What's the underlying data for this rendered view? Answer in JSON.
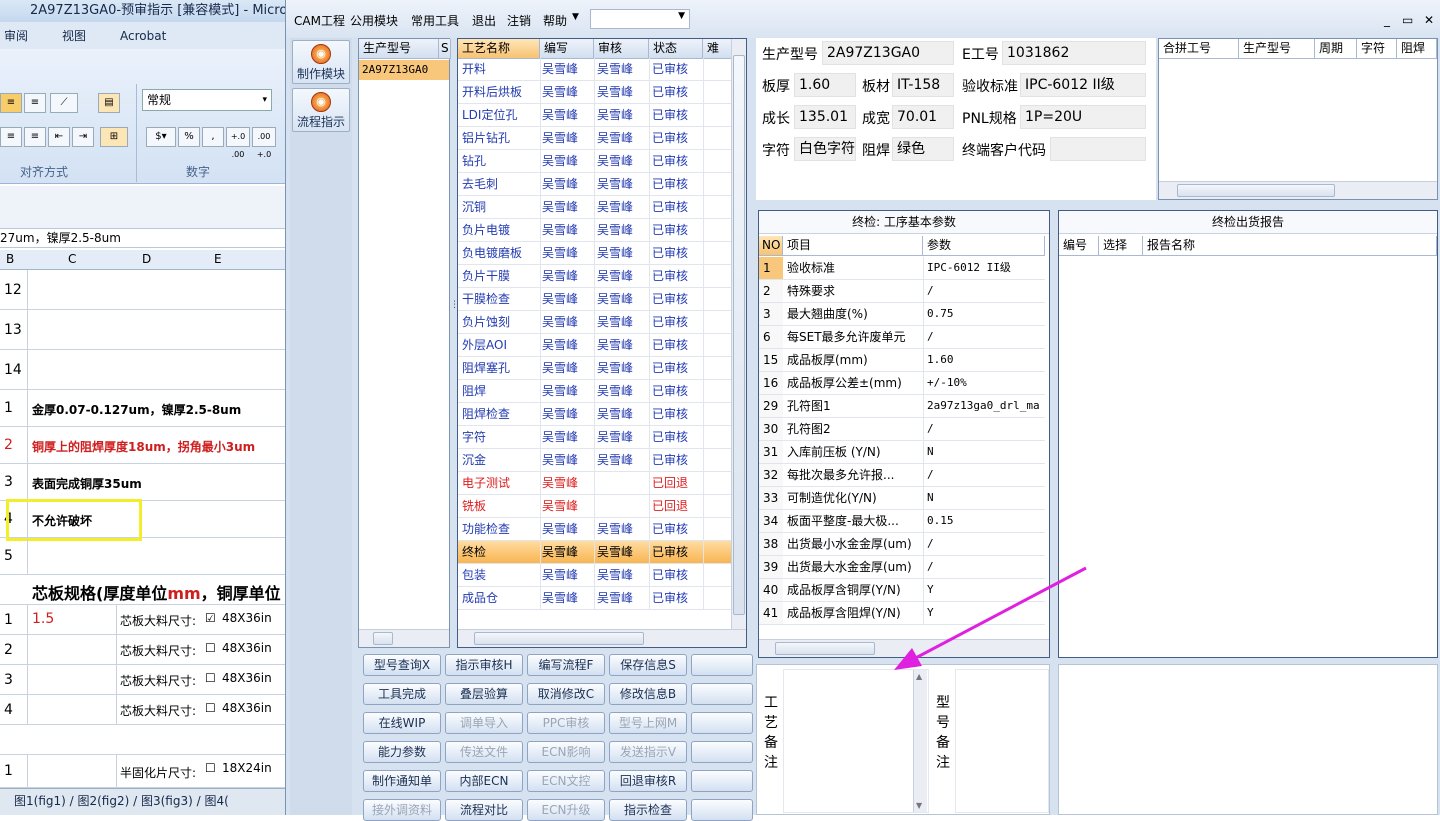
{
  "excel": {
    "title": "2A97Z13GA0-预审指示 [兼容模式] - Microso",
    "tabs": [
      "审阅",
      "视图",
      "Acrobat"
    ],
    "style_value": "常规",
    "groups": [
      "对齐方式",
      "数字"
    ],
    "number_buttons": [
      "%",
      ",",
      "+.0 .00",
      ".00 +.0"
    ],
    "formula": "27um，镍厚2.5-8um",
    "columns": [
      "B",
      "C",
      "D",
      "E"
    ],
    "rows": [
      {
        "n": "12",
        "text": ""
      },
      {
        "n": "13",
        "text": ""
      },
      {
        "n": "14",
        "text": ""
      },
      {
        "n": "1",
        "text": "金厚0.07-0.127um，镍厚2.5-8um"
      },
      {
        "n": "2",
        "text": "铜厚上的阻焊厚度18um，拐角最小3um"
      },
      {
        "n": "3",
        "text": "表面完成铜厚35um"
      },
      {
        "n": "4",
        "text": "不允许破坏"
      },
      {
        "n": "5",
        "text": ""
      }
    ],
    "core_title_a": "芯板规格(厚度单位",
    "core_title_mm": "mm",
    "core_title_b": "，铜厚单位",
    "core_rows": [
      {
        "n": "1",
        "val": "1.5",
        "label": "芯板大料尺寸:",
        "size": "48X36in",
        "checked": true
      },
      {
        "n": "2",
        "val": "",
        "label": "芯板大料尺寸:",
        "size": "48X36in",
        "checked": false
      },
      {
        "n": "3",
        "val": "",
        "label": "芯板大料尺寸:",
        "size": "48X36in",
        "checked": false
      },
      {
        "n": "4",
        "val": "",
        "label": "芯板大料尺寸:",
        "size": "48X36in",
        "checked": false
      }
    ],
    "semi_row": {
      "n": "1",
      "label": "半固化片尺寸:",
      "size": "18X24in"
    },
    "sheets": "图1(fig1) / 图2(fig2) / 图3(fig3) / 图4("
  },
  "menu": [
    "CAM工程",
    "公用模块",
    "常用工具",
    "退出",
    "注销",
    "帮助"
  ],
  "left_buttons": [
    "制作模块",
    "流程指示"
  ],
  "model_list": {
    "headers": [
      "生产型号",
      "S"
    ],
    "items": [
      "2A97Z13GA0"
    ]
  },
  "process": {
    "headers": [
      "工艺名称",
      "编写",
      "审核",
      "状态",
      "难"
    ],
    "rows": [
      {
        "name": "开料",
        "writer": "吴雪峰",
        "reviewer": "吴雪峰",
        "status": "已审核"
      },
      {
        "name": "开料后烘板",
        "writer": "吴雪峰",
        "reviewer": "吴雪峰",
        "status": "已审核"
      },
      {
        "name": "LDI定位孔",
        "writer": "吴雪峰",
        "reviewer": "吴雪峰",
        "status": "已审核"
      },
      {
        "name": "铝片钻孔",
        "writer": "吴雪峰",
        "reviewer": "吴雪峰",
        "status": "已审核"
      },
      {
        "name": "钻孔",
        "writer": "吴雪峰",
        "reviewer": "吴雪峰",
        "status": "已审核"
      },
      {
        "name": "去毛刺",
        "writer": "吴雪峰",
        "reviewer": "吴雪峰",
        "status": "已审核"
      },
      {
        "name": "沉铜",
        "writer": "吴雪峰",
        "reviewer": "吴雪峰",
        "status": "已审核"
      },
      {
        "name": "负片电镀",
        "writer": "吴雪峰",
        "reviewer": "吴雪峰",
        "status": "已审核"
      },
      {
        "name": "负电镀磨板",
        "writer": "吴雪峰",
        "reviewer": "吴雪峰",
        "status": "已审核"
      },
      {
        "name": "负片干膜",
        "writer": "吴雪峰",
        "reviewer": "吴雪峰",
        "status": "已审核"
      },
      {
        "name": "干膜检查",
        "writer": "吴雪峰",
        "reviewer": "吴雪峰",
        "status": "已审核"
      },
      {
        "name": "负片蚀刻",
        "writer": "吴雪峰",
        "reviewer": "吴雪峰",
        "status": "已审核"
      },
      {
        "name": "外层AOI",
        "writer": "吴雪峰",
        "reviewer": "吴雪峰",
        "status": "已审核"
      },
      {
        "name": "阻焊塞孔",
        "writer": "吴雪峰",
        "reviewer": "吴雪峰",
        "status": "已审核"
      },
      {
        "name": "阻焊",
        "writer": "吴雪峰",
        "reviewer": "吴雪峰",
        "status": "已审核"
      },
      {
        "name": "阻焊检查",
        "writer": "吴雪峰",
        "reviewer": "吴雪峰",
        "status": "已审核"
      },
      {
        "name": "字符",
        "writer": "吴雪峰",
        "reviewer": "吴雪峰",
        "status": "已审核"
      },
      {
        "name": "沉金",
        "writer": "吴雪峰",
        "reviewer": "吴雪峰",
        "status": "已审核"
      },
      {
        "name": "电子测试",
        "writer": "吴雪峰",
        "reviewer": "",
        "status": "已回退"
      },
      {
        "name": "铣板",
        "writer": "吴雪峰",
        "reviewer": "",
        "status": "已回退"
      },
      {
        "name": "功能检查",
        "writer": "吴雪峰",
        "reviewer": "吴雪峰",
        "status": "已审核"
      },
      {
        "name": "终检",
        "writer": "吴雪峰",
        "reviewer": "吴雪峰",
        "status": "已审核"
      },
      {
        "name": "包装",
        "writer": "吴雪峰",
        "reviewer": "吴雪峰",
        "status": "已审核"
      },
      {
        "name": "成品仓",
        "writer": "吴雪峰",
        "reviewer": "吴雪峰",
        "status": "已审核"
      }
    ]
  },
  "actions": [
    [
      "型号查询X",
      "指示审核H",
      "编写流程F",
      "保存信息S",
      ""
    ],
    [
      "工具完成",
      "叠层验算",
      "取消修改C",
      "修改信息B",
      ""
    ],
    [
      "在线WIP",
      "调单导入",
      "PPC审核",
      "型号上网M",
      ""
    ],
    [
      "能力参数",
      "传送文件",
      "ECN影响",
      "发送指示V",
      ""
    ],
    [
      "制作通知单",
      "内部ECN",
      "ECN文控",
      "回退审核R",
      ""
    ],
    [
      "接外调资料",
      "流程对比",
      "ECN升级",
      "指示检查",
      ""
    ]
  ],
  "disabled_actions": [
    "调单导入",
    "PPC审核",
    "型号上网M",
    "传送文件",
    "ECN影响",
    "发送指示V",
    "ECN文控",
    "ECN升级",
    "接外调资料"
  ],
  "info": {
    "model_label": "生产型号",
    "model": "2A97Z13GA0",
    "eno_label": "E工号",
    "eno": "1031862",
    "thickness_label": "板厚",
    "thickness": "1.60",
    "material_label": "板材",
    "material": "IT-158",
    "standard_label": "验收标准",
    "standard": "IPC-6012 II级",
    "length_label": "成长",
    "length": "135.01",
    "width_label": "成宽",
    "width": "70.01",
    "pnl_label": "PNL规格",
    "pnl": "1P=20U",
    "char_label": "字符",
    "char": "白色字符",
    "mask_label": "阻焊",
    "mask": "绿色",
    "customer_label": "终端客户代码",
    "customer": ""
  },
  "merge_headers": [
    "合拼工号",
    "生产型号",
    "周期",
    "字符",
    "阻焊"
  ],
  "params": {
    "title": "终检: 工序基本参数",
    "headers": [
      "NO",
      "项目",
      "参数"
    ],
    "rows": [
      {
        "no": "1",
        "item": "验收标准",
        "value": "IPC-6012 II级"
      },
      {
        "no": "2",
        "item": "特殊要求",
        "value": "/"
      },
      {
        "no": "3",
        "item": "最大翘曲度(%)",
        "value": "0.75"
      },
      {
        "no": "6",
        "item": "每SET最多允许废单元",
        "value": "/"
      },
      {
        "no": "15",
        "item": "成品板厚(mm)",
        "value": "1.60"
      },
      {
        "no": "16",
        "item": "成品板厚公差±(mm)",
        "value": "+/-10%"
      },
      {
        "no": "29",
        "item": "孔符图1",
        "value": "2a97z13ga0_drl_ma"
      },
      {
        "no": "30",
        "item": "孔符图2",
        "value": "/"
      },
      {
        "no": "31",
        "item": "入库前压板 (Y/N)",
        "value": "N"
      },
      {
        "no": "32",
        "item": "每批次最多允许报...",
        "value": "/"
      },
      {
        "no": "33",
        "item": "可制造优化(Y/N)",
        "value": "N"
      },
      {
        "no": "34",
        "item": "板面平整度-最大极...",
        "value": "0.15"
      },
      {
        "no": "38",
        "item": "出货最小水金金厚(um)",
        "value": "/"
      },
      {
        "no": "39",
        "item": "出货最大水金金厚(um)",
        "value": "/"
      },
      {
        "no": "40",
        "item": "成品板厚含铜厚(Y/N)",
        "value": "Y"
      },
      {
        "no": "41",
        "item": "成品板厚含阻焊(Y/N)",
        "value": "Y"
      }
    ]
  },
  "report": {
    "title": "终检出货报告",
    "headers": [
      "编号",
      "选择",
      "报告名称"
    ]
  },
  "remarks": {
    "process_label": "工艺备注",
    "model_label": "型号备注"
  },
  "colors": {
    "accent_arrow": "#e020e0",
    "selected_row": "#f8b552",
    "highlight_box": "#f2ee2a"
  }
}
